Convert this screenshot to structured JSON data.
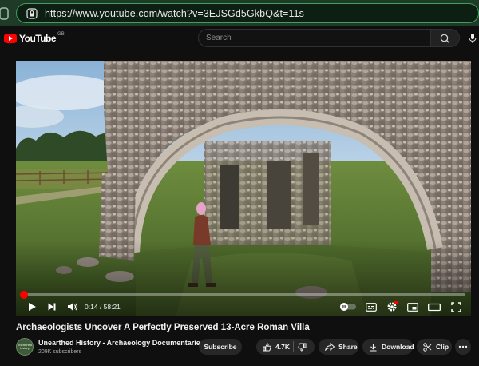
{
  "browser": {
    "url": "https://www.youtube.com/watch?v=3EJSGd5GkbQ&t=11s",
    "url_bar_color": "#3fa05b"
  },
  "header": {
    "logo_text": "YouTube",
    "country_code": "GB",
    "search_placeholder": "Search",
    "icons": [
      "search-icon",
      "microphone-icon"
    ]
  },
  "player": {
    "current_time": "0:14",
    "duration": "58:21",
    "time_display": "0:14 / 58:21",
    "progress_fraction": 0.004,
    "autoplay": "off",
    "accent_color": "#ff0000",
    "icons": [
      "play-icon",
      "next-icon",
      "volume-icon",
      "autoplay-toggle",
      "subtitles-icon",
      "settings-icon",
      "miniplayer-icon",
      "theater-icon",
      "fullscreen-icon"
    ]
  },
  "video": {
    "title": "Archaeologists Uncover A Perfectly Preserved 13-Acre Roman Villa"
  },
  "channel": {
    "name": "Unearthed History - Archaeology Documentaries",
    "subscribers": "209K subscribers",
    "avatar_text": "unearthed history"
  },
  "actions": {
    "subscribe": "Subscribe",
    "likes": "4.7K",
    "share": "Share",
    "download": "Download",
    "clip": "Clip"
  }
}
